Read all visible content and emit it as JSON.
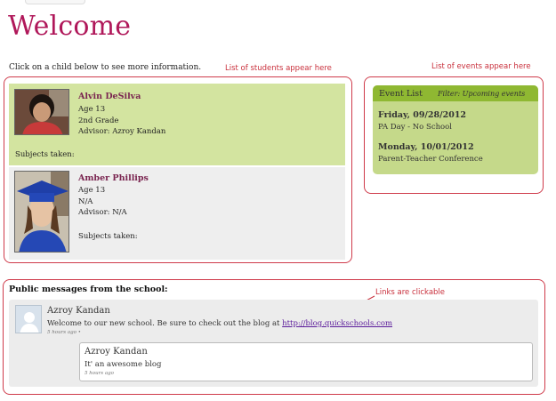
{
  "page": {
    "title": "Welcome",
    "instruction": "Click on a child below to see more information."
  },
  "annotations": {
    "students": "List of students appear here",
    "events": "List of events appear here",
    "links": "Links are clickable"
  },
  "students": [
    {
      "name": "Alvin DeSilva",
      "age": "Age 13",
      "grade": "2nd Grade",
      "advisor": "Advisor: Azroy Kandan",
      "subjects": "Subjects taken:"
    },
    {
      "name": "Amber Phillips",
      "age": "Age 13",
      "grade": "N/A",
      "advisor": "Advisor: N/A",
      "subjects": "Subjects taken:"
    }
  ],
  "events": {
    "title": "Event List",
    "filter": "Filter: Upcoming events",
    "items": [
      {
        "date": "Friday, 09/28/2012",
        "desc": "PA Day - No School"
      },
      {
        "date": "Monday, 10/01/2012",
        "desc": "Parent-Teacher Conference"
      }
    ]
  },
  "messages": {
    "title": "Public messages from the school:",
    "post": {
      "author": "Azroy Kandan",
      "text": "Welcome to our new school. Be sure to check out the blog at ",
      "link": "http://blog.quickschools.com",
      "meta": "5 hours ago",
      "meta_sep": "•"
    },
    "reply": {
      "author": "Azroy Kandan",
      "text": "It' an awesome blog",
      "meta": "5 hours ago"
    }
  },
  "colors": {
    "accent": "#b0185a",
    "annotation": "#c9303c",
    "selected_row": "#d3e4a0",
    "event_header": "#8fb832"
  }
}
